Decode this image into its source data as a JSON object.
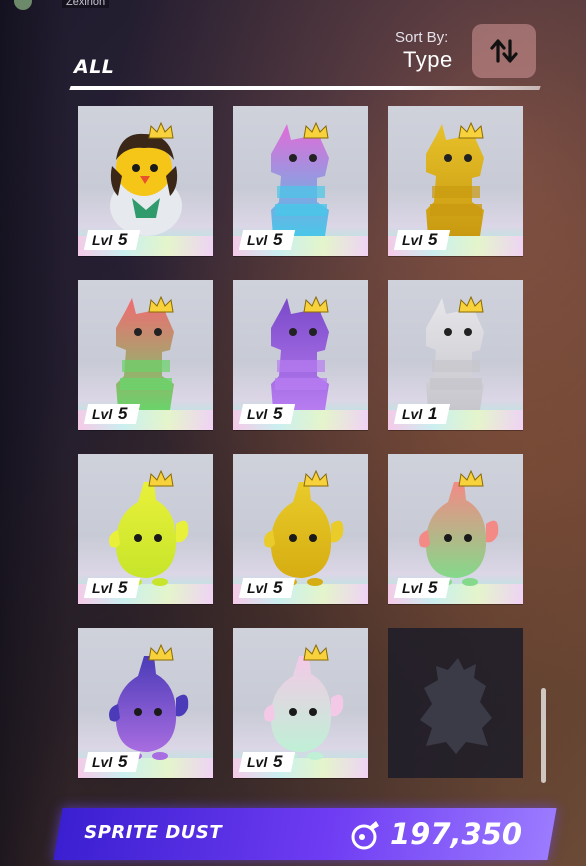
{
  "topbar": {
    "username": "Zexirion"
  },
  "filter": {
    "label": "ALL"
  },
  "sort": {
    "title": "Sort By:",
    "value": "Type"
  },
  "sprites": [
    {
      "level_prefix": "Lvl",
      "level": "5",
      "kind": "chick-head",
      "colors": [
        "#f5c518",
        "#3b2718"
      ]
    },
    {
      "level_prefix": "Lvl",
      "level": "5",
      "kind": "llama",
      "colors": [
        "#e26bd8",
        "#49c7e8"
      ]
    },
    {
      "level_prefix": "Lvl",
      "level": "5",
      "kind": "llama",
      "colors": [
        "#e7c12a",
        "#c99a10"
      ]
    },
    {
      "level_prefix": "Lvl",
      "level": "5",
      "kind": "llama",
      "colors": [
        "#f26a72",
        "#6ad36a"
      ]
    },
    {
      "level_prefix": "Lvl",
      "level": "5",
      "kind": "llama",
      "colors": [
        "#7a49c9",
        "#b77cf0"
      ]
    },
    {
      "level_prefix": "Lvl",
      "level": "1",
      "kind": "llama",
      "colors": [
        "#e6e6ea",
        "#c6c6cc"
      ]
    },
    {
      "level_prefix": "Lvl",
      "level": "5",
      "kind": "blob",
      "colors": [
        "#e9f03a",
        "#c7e52a"
      ]
    },
    {
      "level_prefix": "Lvl",
      "level": "5",
      "kind": "blob",
      "colors": [
        "#e9cb2a",
        "#d6ad12"
      ]
    },
    {
      "level_prefix": "Lvl",
      "level": "5",
      "kind": "blob",
      "colors": [
        "#f38a86",
        "#84d98a"
      ]
    },
    {
      "level_prefix": "Lvl",
      "level": "5",
      "kind": "blob",
      "colors": [
        "#4b3bb8",
        "#a86de0"
      ]
    },
    {
      "level_prefix": "Lvl",
      "level": "5",
      "kind": "blob",
      "colors": [
        "#f4c9e7",
        "#bff0d6"
      ]
    }
  ],
  "currency": {
    "label": "SPRITE DUST",
    "amount": "197,350",
    "icon": "sprite-dust-icon"
  },
  "colors": {
    "accent": "#6f3cf3",
    "crown": "#f7d23c"
  }
}
